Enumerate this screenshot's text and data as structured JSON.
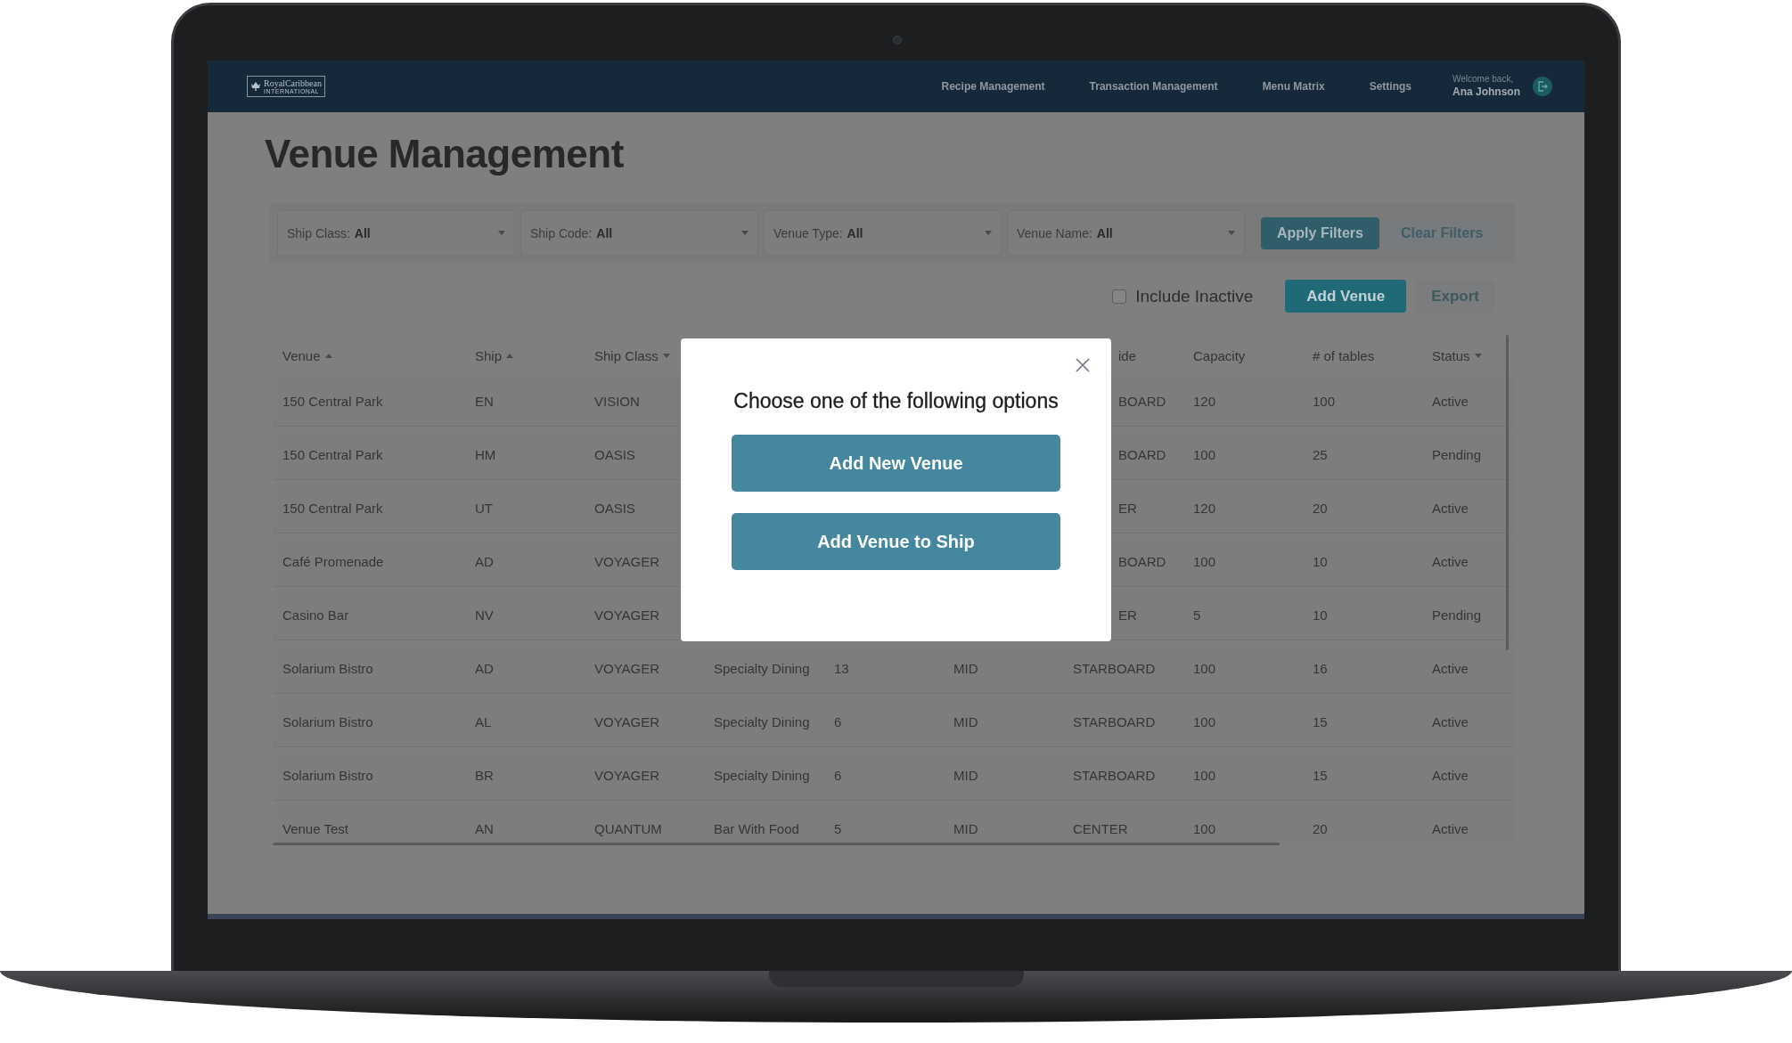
{
  "nav": {
    "logo": {
      "name": "RoyalCaribbean",
      "tagline": "INTERNATIONAL"
    },
    "items": [
      "Recipe Management",
      "Transaction Management",
      "Menu Matrix",
      "Settings"
    ],
    "welcome": "Welcome back,",
    "user": "Ana Johnson"
  },
  "page_title": "Venue Management",
  "filters": [
    {
      "label": "Ship Class:",
      "value": "All"
    },
    {
      "label": "Ship Code:",
      "value": "All"
    },
    {
      "label": "Venue Type:",
      "value": "All"
    },
    {
      "label": "Venue Name:",
      "value": "All"
    }
  ],
  "filter_buttons": [
    {
      "label": "Apply Filters",
      "kind": "primary"
    },
    {
      "label": "Clear Filters",
      "kind": "secondary"
    }
  ],
  "include_inactive": {
    "label": "Include Inactive",
    "checked": false
  },
  "actions": [
    {
      "label": "Add Venue",
      "kind": "primary"
    },
    {
      "label": "Export",
      "kind": "secondary"
    }
  ],
  "table": {
    "columns": [
      {
        "label": "Venue",
        "ascending": true
      },
      {
        "label": "Ship",
        "ascending": true
      },
      {
        "label": "Ship Class",
        "ascending": false
      },
      null,
      null,
      null,
      {
        "label": "ide"
      },
      {
        "label": "Capacity"
      },
      {
        "label": "# of tables"
      },
      {
        "label": "Status",
        "ascending": false
      }
    ],
    "rows": [
      [
        "150 Central Park",
        "EN",
        "VISION",
        null,
        null,
        null,
        "BOARD",
        "120",
        "100",
        "Active"
      ],
      [
        "150 Central Park",
        "HM",
        "OASIS",
        null,
        null,
        null,
        "BOARD",
        "100",
        "25",
        "Pending"
      ],
      [
        "150 Central Park",
        "UT",
        "OASIS",
        null,
        null,
        null,
        "ER",
        "120",
        "20",
        "Active"
      ],
      [
        "Café Promenade",
        "AD",
        "VOYAGER",
        null,
        null,
        null,
        "BOARD",
        "100",
        "10",
        "Active"
      ],
      [
        "Casino Bar",
        "NV",
        "VOYAGER",
        null,
        null,
        null,
        "ER",
        "5",
        "10",
        "Pending"
      ],
      [
        "Solarium Bistro",
        "AD",
        "VOYAGER",
        "Specialty Dining",
        "13",
        "MID",
        "STARBOARD",
        "100",
        "16",
        "Active"
      ],
      [
        "Solarium Bistro",
        "AL",
        "VOYAGER",
        "Specialty Dining",
        "6",
        "MID",
        "STARBOARD",
        "100",
        "15",
        "Active"
      ],
      [
        "Solarium Bistro",
        "BR",
        "VOYAGER",
        "Specialty Dining",
        "6",
        "MID",
        "STARBOARD",
        "100",
        "15",
        "Active"
      ],
      [
        "Venue Test",
        "AN",
        "QUANTUM",
        "Bar With Food",
        "5",
        "MID",
        "CENTER",
        "100",
        "20",
        "Active"
      ]
    ]
  },
  "modal": {
    "title": "Choose one of the following options",
    "options": [
      "Add New Venue",
      "Add Venue to Ship"
    ]
  }
}
